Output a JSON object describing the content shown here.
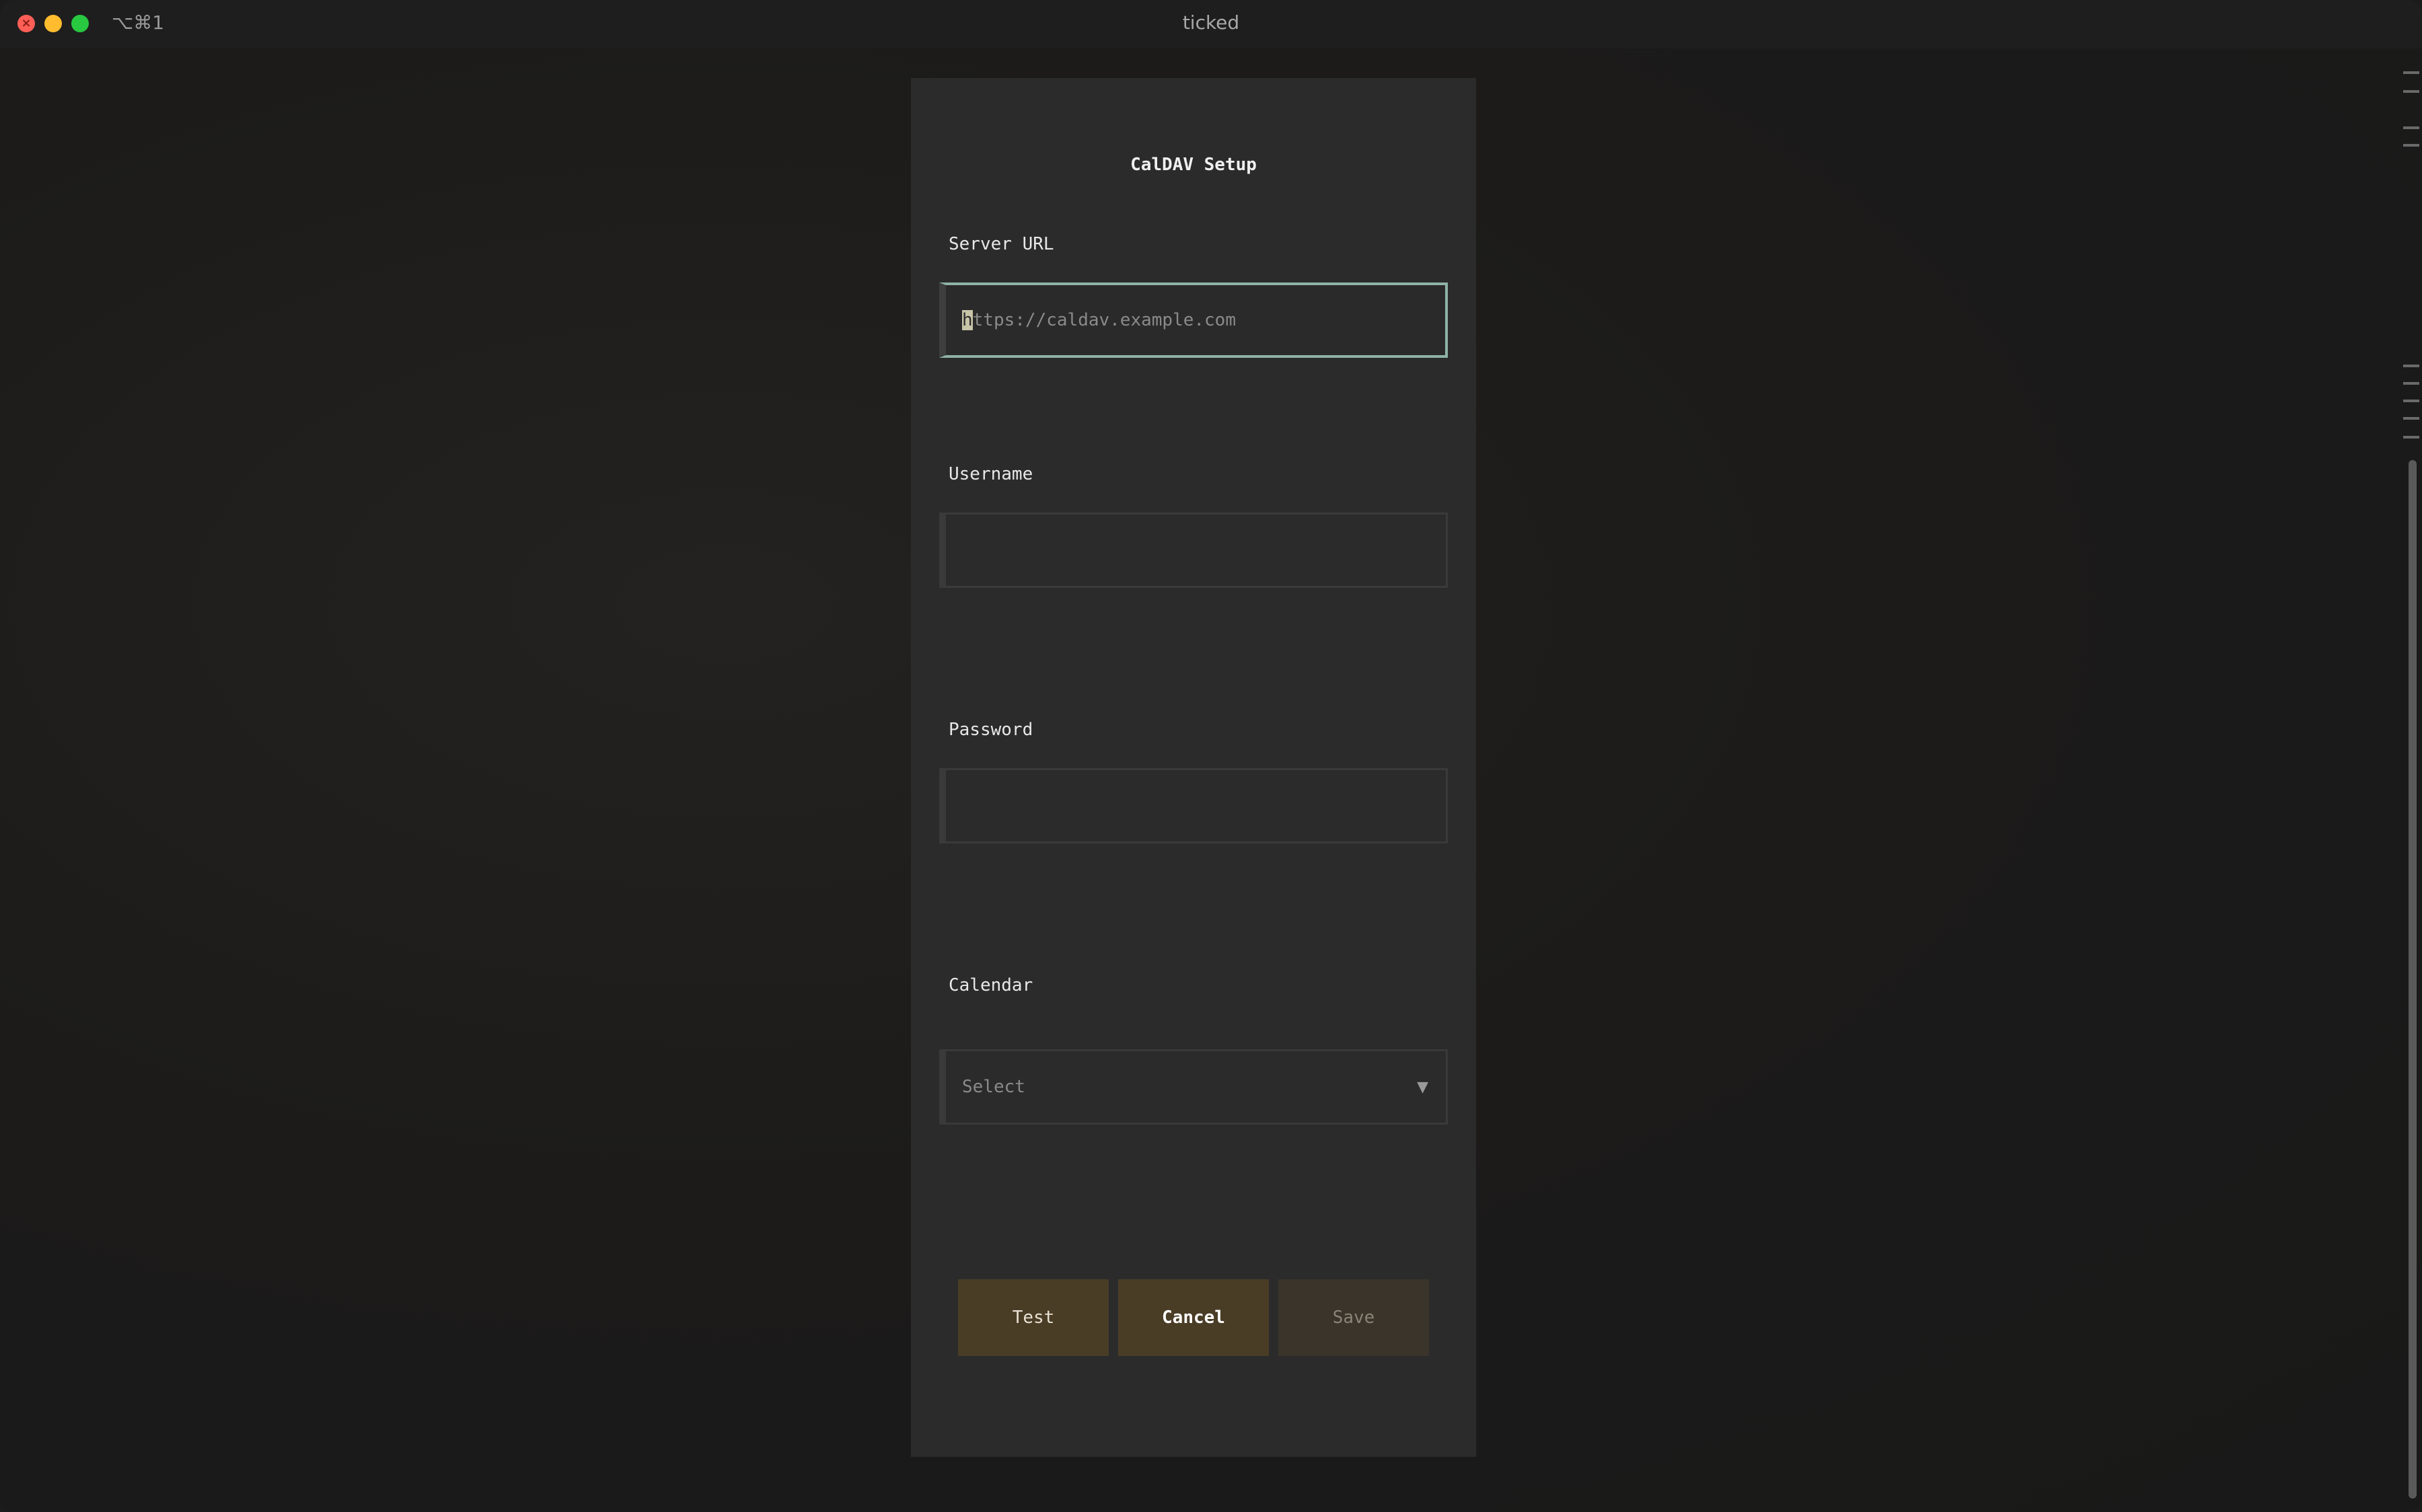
{
  "window": {
    "title": "ticked",
    "shortcut": "⌥⌘1"
  },
  "dialog": {
    "title": "CalDAV Setup",
    "fields": {
      "server_url": {
        "label": "Server URL",
        "value": "",
        "placeholder": "https://caldav.example.com",
        "placeholder_first": "h",
        "placeholder_rest": "ttps://caldav.example.com"
      },
      "username": {
        "label": "Username",
        "value": ""
      },
      "password": {
        "label": "Password",
        "value": ""
      },
      "calendar": {
        "label": "Calendar",
        "selected": "Select",
        "arrow": "▼"
      }
    },
    "buttons": {
      "test": "Test",
      "cancel": "Cancel",
      "save": "Save"
    }
  },
  "colors": {
    "background": "#1b1b1b",
    "dialog": "#2b2b2b",
    "focus_border": "#8fb3a6",
    "button_primary": "#4a3d26",
    "button_disabled": "#3a342a"
  }
}
